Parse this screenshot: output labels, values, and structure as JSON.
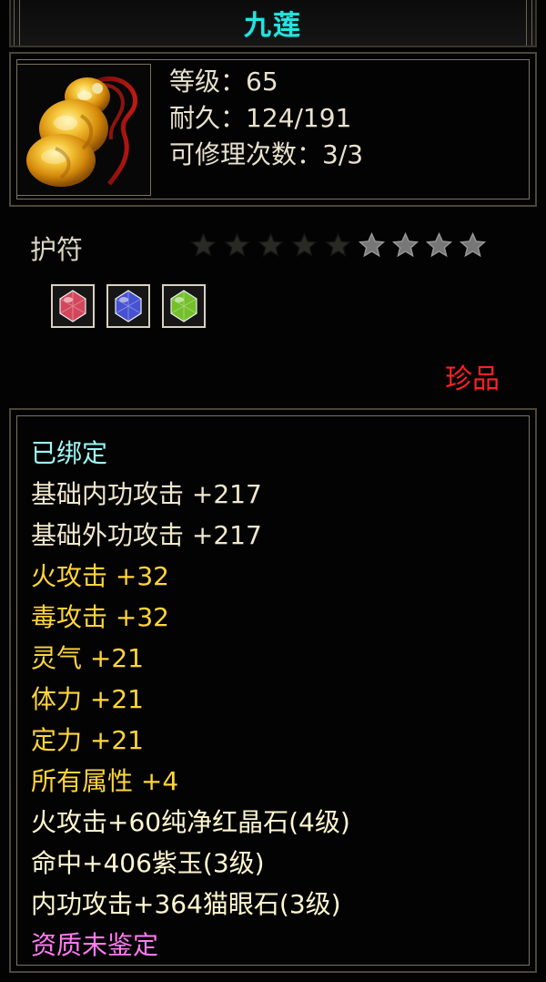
{
  "item": {
    "name": "九莲",
    "icon": "gourd-amulet-icon",
    "level_label": "等级：65",
    "durability_label": "耐久：124/191",
    "repair_label": "可修理次数：3/3",
    "type_label": "护符",
    "stars": {
      "filled": 5,
      "total": 9
    },
    "gems": [
      {
        "name": "red-gem-icon",
        "color": "#e44c63"
      },
      {
        "name": "purple-gem-icon",
        "color": "#4b56e4"
      },
      {
        "name": "green-gem-icon",
        "color": "#7dcf2d"
      }
    ],
    "rarity": "珍品"
  },
  "attributes": [
    {
      "text": "已绑定",
      "kind": "bound"
    },
    {
      "text": "基础内功攻击  +217",
      "kind": "base"
    },
    {
      "text": "基础外功攻击  +217",
      "kind": "base"
    },
    {
      "text": "火攻击  +32",
      "kind": "bonus"
    },
    {
      "text": "毒攻击  +32",
      "kind": "bonus"
    },
    {
      "text": "灵气  +21",
      "kind": "bonus"
    },
    {
      "text": "体力  +21",
      "kind": "bonus"
    },
    {
      "text": "定力  +21",
      "kind": "bonus"
    },
    {
      "text": "所有属性  +4",
      "kind": "bonus"
    },
    {
      "text": "火攻击+60纯净红晶石(4级)",
      "kind": "socket"
    },
    {
      "text": "命中+406紫玉(3级)",
      "kind": "socket"
    },
    {
      "text": "内功攻击+364猫眼石(3级)",
      "kind": "socket"
    },
    {
      "text": "资质未鉴定",
      "kind": "quality"
    }
  ],
  "colors": {
    "title": "#29e2df",
    "bound": "#9ff7f7",
    "base": "#f1e8cd",
    "bonus": "#ffd53a",
    "socket": "#fff7d0",
    "quality": "#ff7bf1",
    "rarity": "#ff2027",
    "star_filled": "#2a2a24",
    "star_empty": "#777777"
  }
}
